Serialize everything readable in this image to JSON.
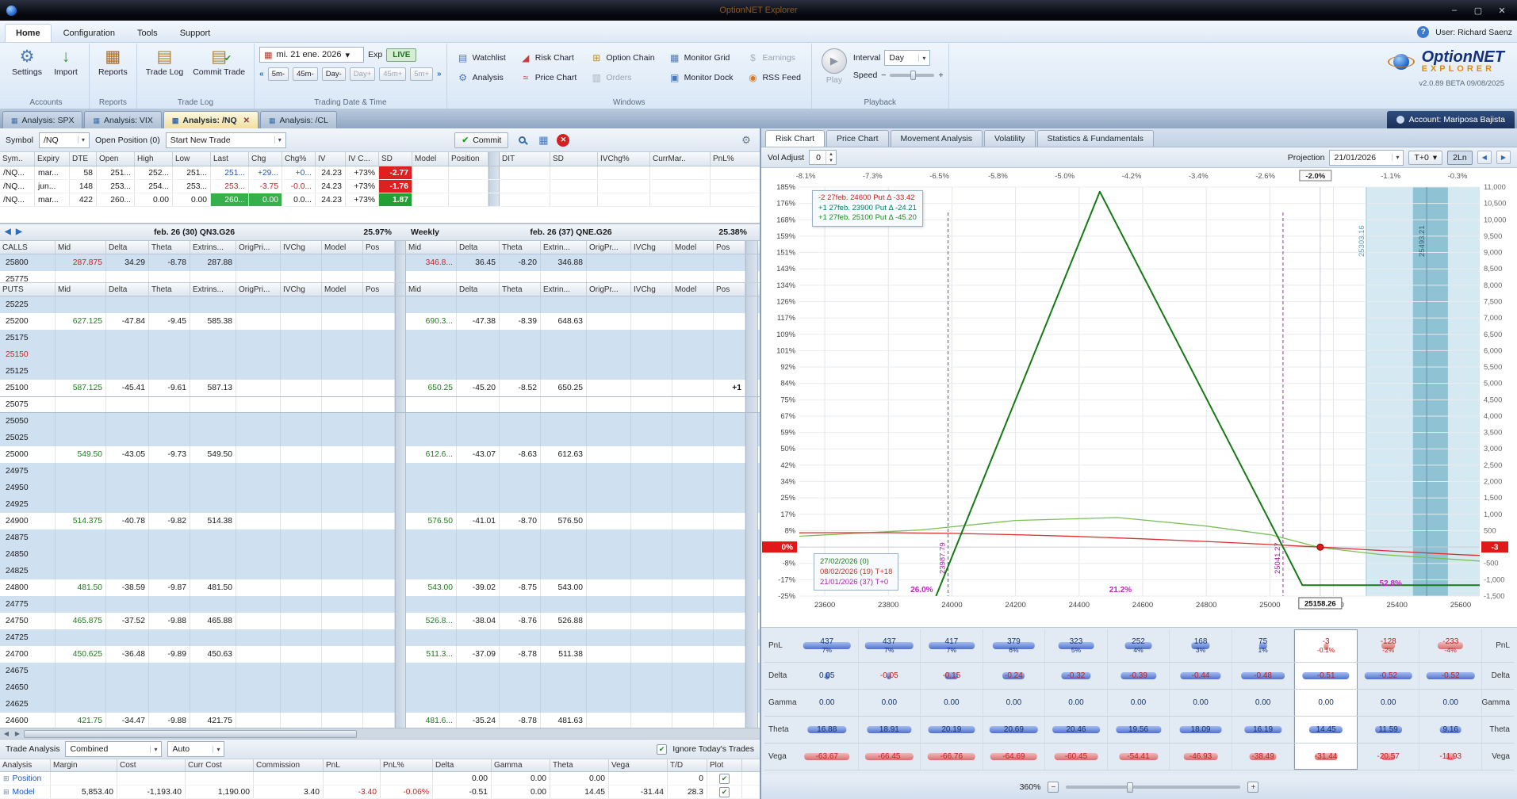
{
  "titlebar": {
    "title": "OptionNET Explorer",
    "minimize": "–",
    "maximize": "▢",
    "close": "✕"
  },
  "menubar": {
    "items": [
      "Home",
      "Configuration",
      "Tools",
      "Support"
    ],
    "help": "?",
    "user": "User: Richard Saenz"
  },
  "ribbon": {
    "accounts": {
      "label": "Accounts",
      "settings": "Settings",
      "import": "Import"
    },
    "reports": {
      "label": "Reports",
      "reports": "Reports"
    },
    "tradelog": {
      "label": "Trade Log",
      "trade_log": "Trade Log",
      "commit_trade": "Commit Trade"
    },
    "datetime": {
      "label": "Trading Date & Time",
      "date": "mi. 21 ene. 2026",
      "exp": "Exp",
      "live": "LIVE",
      "steps": [
        "5m-",
        "45m-",
        "Day-",
        "Day+",
        "45m+",
        "5m+"
      ]
    },
    "windows": {
      "label": "Windows",
      "items": [
        {
          "label": "Watchlist",
          "icon": "watchlist-icon",
          "enabled": true
        },
        {
          "label": "Analysis",
          "icon": "analysis-icon",
          "enabled": true
        },
        {
          "label": "Risk Chart",
          "icon": "risk-chart-icon",
          "enabled": true
        },
        {
          "label": "Price Chart",
          "icon": "price-chart-icon",
          "enabled": true
        },
        {
          "label": "Option Chain",
          "icon": "option-chain-icon",
          "enabled": true
        },
        {
          "label": "Orders",
          "icon": "orders-icon",
          "enabled": false
        },
        {
          "label": "Monitor Grid",
          "icon": "monitor-grid-icon",
          "enabled": true
        },
        {
          "label": "Monitor Dock",
          "icon": "monitor-dock-icon",
          "enabled": true
        },
        {
          "label": "Earnings",
          "icon": "earnings-icon",
          "enabled": false
        },
        {
          "label": "RSS Feed",
          "icon": "rss-feed-icon",
          "enabled": true
        }
      ]
    },
    "playback": {
      "label": "Playback",
      "play": "Play",
      "interval_label": "Interval",
      "interval_value": "Day",
      "speed_label": "Speed"
    },
    "logo": {
      "name1": "OptionNET",
      "name2": "EXPLORER",
      "version": "v2.0.89 BETA 09/08/2025"
    }
  },
  "tabstrip": {
    "tabs": [
      {
        "label": "Analysis: SPX"
      },
      {
        "label": "Analysis: VIX"
      },
      {
        "label": "Analysis: /NQ",
        "active": true
      },
      {
        "label": "Analysis: /CL"
      }
    ],
    "account": "Account: Mariposa Bajista"
  },
  "left": {
    "toolbar": {
      "symbol_label": "Symbol",
      "symbol_value": "/NQ",
      "open_position": "Open Position (0)",
      "trade_combo": "Start New Trade",
      "commit": "Commit"
    },
    "futures": {
      "headers": [
        "Sym..",
        "Expiry",
        "DTE",
        "Open",
        "High",
        "Low",
        "Last",
        "Chg",
        "Chg%",
        "IV",
        "IV C...",
        "SD",
        "Model",
        "Position"
      ],
      "headers2": [
        "DIT",
        "SD",
        "IVChg%",
        "CurrMar..",
        "PnL%"
      ],
      "rows": [
        {
          "cells": [
            "/NQ...",
            "mar...",
            "58",
            "251...",
            "252...",
            "251...",
            "251...",
            "+29...",
            "+0...",
            "24.23",
            "+73%",
            "-2.77",
            "",
            ""
          ],
          "cls": {
            "6": "c-up",
            "7": "c-up",
            "8": "c-up",
            "11": "badge-red"
          }
        },
        {
          "cells": [
            "/NQ...",
            "jun...",
            "148",
            "253...",
            "254...",
            "253...",
            "253...",
            "-3.75",
            "-0.0...",
            "24.23",
            "+73%",
            "-1.76",
            "",
            ""
          ],
          "cls": {
            "6": "c-dn",
            "7": "c-dn",
            "8": "c-dn",
            "11": "badge-red"
          }
        },
        {
          "cells": [
            "/NQ...",
            "mar...",
            "422",
            "260...",
            "0.00",
            "0.00",
            "260...",
            "0.00",
            "0.0...",
            "24.23",
            "+73%",
            "1.87",
            "",
            ""
          ],
          "cls": {
            "6": "flash-up",
            "7": "flash-up",
            "11": "badge-green"
          }
        }
      ]
    },
    "chain": {
      "exp1": {
        "title": "feb. 26 (30)  QN3.G26",
        "iv": "25.97%"
      },
      "exp2": {
        "prefix": "Weekly",
        "title": "feb. 26 (37)  QNE.G26",
        "iv": "25.38%"
      },
      "calls_label": "CALLS",
      "puts_label": "PUTS",
      "col_headers": [
        "Mid",
        "Delta",
        "Theta",
        "Extrins...",
        "OrigPri...",
        "IVChg",
        "Model",
        "Pos"
      ],
      "col_headers2": [
        "Mid",
        "Delta",
        "Theta",
        "Extrin...",
        "OrigPr...",
        "IVChg",
        "Model",
        "Pos"
      ],
      "calls": [
        {
          "strike": "25800",
          "bg": "b",
          "g1": [
            "287.875",
            "34.29",
            "-8.78",
            "287.88"
          ],
          "g2": [
            "346.8...",
            "36.45",
            "-8.20",
            "346.88"
          ]
        },
        {
          "strike": "25775",
          "bg": "w"
        }
      ],
      "puts": [
        {
          "strike": "25225"
        },
        {
          "strike": "25200",
          "g1": [
            "627.125",
            "-47.84",
            "-9.45",
            "585.38"
          ],
          "g2": [
            "690.3...",
            "-47.38",
            "-8.39",
            "648.63"
          ]
        },
        {
          "strike": "25175"
        },
        {
          "strike": "25150",
          "sc": "red"
        },
        {
          "strike": "25125"
        },
        {
          "strike": "25100",
          "g1": [
            "587.125",
            "-45.41",
            "-9.61",
            "587.13"
          ],
          "g2": [
            "650.25",
            "-45.20",
            "-8.52",
            "650.25"
          ],
          "pos2": "+1"
        },
        {
          "strike": "25075",
          "sel": true
        },
        {
          "strike": "25050"
        },
        {
          "strike": "25025"
        },
        {
          "strike": "25000",
          "g1": [
            "549.50",
            "-43.05",
            "-9.73",
            "549.50"
          ],
          "g2": [
            "612.6...",
            "-43.07",
            "-8.63",
            "612.63"
          ]
        },
        {
          "strike": "24975"
        },
        {
          "strike": "24950"
        },
        {
          "strike": "24925"
        },
        {
          "strike": "24900",
          "g1": [
            "514.375",
            "-40.78",
            "-9.82",
            "514.38"
          ],
          "g2": [
            "576.50",
            "-41.01",
            "-8.70",
            "576.50"
          ]
        },
        {
          "strike": "24875"
        },
        {
          "strike": "24850"
        },
        {
          "strike": "24825"
        },
        {
          "strike": "24800",
          "g1": [
            "481.50",
            "-38.59",
            "-9.87",
            "481.50"
          ],
          "g2": [
            "543.00",
            "-39.02",
            "-8.75",
            "543.00"
          ]
        },
        {
          "strike": "24775"
        },
        {
          "strike": "24750",
          "g1": [
            "465.875",
            "-37.52",
            "-9.88",
            "465.88"
          ],
          "g2": [
            "526.8...",
            "-38.04",
            "-8.76",
            "526.88"
          ]
        },
        {
          "strike": "24725"
        },
        {
          "strike": "24700",
          "g1": [
            "450.625",
            "-36.48",
            "-9.89",
            "450.63"
          ],
          "g2": [
            "511.3...",
            "-37.09",
            "-8.78",
            "511.38"
          ]
        },
        {
          "strike": "24675"
        },
        {
          "strike": "24650"
        },
        {
          "strike": "24625"
        },
        {
          "strike": "24600",
          "g1": [
            "421.75",
            "-34.47",
            "-9.88",
            "421.75"
          ],
          "g2": [
            "481.6...",
            "-35.24",
            "-8.78",
            "481.63"
          ]
        }
      ]
    },
    "analysis": {
      "trade_analysis_label": "Trade Analysis",
      "combined": "Combined",
      "auto": "Auto",
      "ignore": "Ignore Today's Trades",
      "headers": [
        "Analysis",
        "Margin",
        "Cost",
        "Curr Cost",
        "Commission",
        "PnL",
        "PnL%",
        "Delta",
        "Gamma",
        "Theta",
        "Vega",
        "T/D",
        "Plot"
      ],
      "rows": [
        {
          "name": "Position",
          "cells": [
            "",
            "",
            "",
            "",
            "",
            "",
            "0.00",
            "0.00",
            "0.00",
            "",
            "0"
          ],
          "plot": true
        },
        {
          "name": "Model",
          "cells": [
            "5,853.40",
            "-1,193.40",
            "1,190.00",
            "3.40",
            "-3.40",
            "-0.06%",
            "-0.51",
            "0.00",
            "14.45",
            "-31.44",
            "28.3"
          ],
          "cls": {
            "4": "c-red",
            "5": "c-red"
          },
          "plot": true
        }
      ]
    }
  },
  "right": {
    "tabs": [
      {
        "label": "Risk Chart",
        "active": true
      },
      {
        "label": "Price Chart"
      },
      {
        "label": "Movement Analysis"
      },
      {
        "label": "Volatility"
      },
      {
        "label": "Statistics & Fundamentals"
      }
    ],
    "controls": {
      "vol_adjust_label": "Vol Adjust",
      "vol_adjust_value": "0",
      "projection_label": "Projection",
      "projection_date": "21/01/2026",
      "t0": "T+0",
      "lines": "2Ln"
    },
    "chart": {
      "x_range": [
        23520,
        25660
      ],
      "y_range": [
        -1500,
        11000
      ],
      "x_ticks": [
        23600,
        23800,
        24000,
        24200,
        24400,
        24600,
        24800,
        25000,
        25200,
        25400,
        25600
      ],
      "y_ticks": [
        {
          "v": 11000,
          "d": "11,000",
          "p": "185%"
        },
        {
          "v": 10500,
          "d": "10,500",
          "p": "176%"
        },
        {
          "v": 10000,
          "d": "10,000",
          "p": "168%"
        },
        {
          "v": 9500,
          "d": "9,500",
          "p": "159%"
        },
        {
          "v": 9000,
          "d": "9,000",
          "p": "151%"
        },
        {
          "v": 8500,
          "d": "8,500",
          "p": "143%"
        },
        {
          "v": 8000,
          "d": "8,000",
          "p": "134%"
        },
        {
          "v": 7500,
          "d": "7,500",
          "p": "126%"
        },
        {
          "v": 7000,
          "d": "7,000",
          "p": "117%"
        },
        {
          "v": 6500,
          "d": "6,500",
          "p": "109%"
        },
        {
          "v": 6000,
          "d": "6,000",
          "p": "101%"
        },
        {
          "v": 5500,
          "d": "5,500",
          "p": "92%"
        },
        {
          "v": 5000,
          "d": "5,000",
          "p": "84%"
        },
        {
          "v": 4500,
          "d": "4,500",
          "p": "75%"
        },
        {
          "v": 4000,
          "d": "4,000",
          "p": "67%"
        },
        {
          "v": 3500,
          "d": "3,500",
          "p": "59%"
        },
        {
          "v": 3000,
          "d": "3,000",
          "p": "50%"
        },
        {
          "v": 2500,
          "d": "2,500",
          "p": "42%"
        },
        {
          "v": 2000,
          "d": "2,000",
          "p": "34%"
        },
        {
          "v": 1500,
          "d": "1,500",
          "p": "25%"
        },
        {
          "v": 1000,
          "d": "1,000",
          "p": "17%"
        },
        {
          "v": 500,
          "d": "500",
          "p": "8%"
        },
        {
          "v": 0,
          "d": "-3",
          "p": "0%",
          "badge": true
        },
        {
          "v": -500,
          "d": "-500",
          "p": "-8%"
        },
        {
          "v": -1000,
          "d": "-1,000",
          "p": "-17%"
        },
        {
          "v": -1500,
          "d": "-1,500",
          "p": "-25%"
        }
      ],
      "top_axis": [
        {
          "t": "-8.1%"
        },
        {
          "t": "-7.3%"
        },
        {
          "t": "-6.5%"
        },
        {
          "t": "-5.8%"
        },
        {
          "t": "-5.0%"
        },
        {
          "t": "-4.2%"
        },
        {
          "t": "-3.4%"
        },
        {
          "t": "-2.6%"
        },
        {
          "t": "-2.0%",
          "boxed": true
        },
        {
          "t": "-1.1%"
        },
        {
          "t": "-0.3%"
        }
      ],
      "current_price_label": "25158.26",
      "marker": {
        "price": 25158.26,
        "value": -3
      },
      "breakevens": [
        {
          "price": 23987.79,
          "label": "23987.79"
        },
        {
          "price": 25041.27,
          "label": "25041.27"
        }
      ],
      "sd_band": {
        "line1": {
          "price": 25303.16,
          "label": "25303.16"
        },
        "line2": {
          "price": 25493.21,
          "label": "25493.21"
        },
        "fill_from": 25303.16,
        "inner_from": 25450,
        "inner_to": 25560
      },
      "prob_labels": [
        {
          "text": "26.0%",
          "price": 23905
        },
        {
          "text": "21.2%",
          "price": 24530
        },
        {
          "text": "52.8%",
          "price": 25380,
          "dy": -8
        }
      ],
      "legend": [
        {
          "text": "-2 27feb. 24600 Put Δ -33.42",
          "color": "#cc2222"
        },
        {
          "text": "+1 27feb. 23900 Put Δ -24.21",
          "color": "#008060"
        },
        {
          "text": "+1 27feb. 25100 Put Δ -45.20",
          "color": "#1e8a1e"
        }
      ],
      "tooltip": [
        {
          "text": "27/02/2026 (0)",
          "color": "#1e7d1e"
        },
        {
          "text": "08/02/2026 (19) T+18",
          "color": "#c03a2a"
        },
        {
          "text": "21/01/2026 (37) T+0",
          "color": "#b01eb0"
        }
      ],
      "series": {
        "t18": {
          "color": "#7cbf5a",
          "width": 1.3,
          "points": [
            [
              23520,
              330
            ],
            [
              23900,
              520
            ],
            [
              24200,
              810
            ],
            [
              24520,
              900
            ],
            [
              24800,
              640
            ],
            [
              25004,
              370
            ],
            [
              25158.26,
              -20
            ],
            [
              25350,
              -230
            ],
            [
              25660,
              -430
            ]
          ]
        },
        "t0": {
          "color": "#d93030",
          "width": 1.3,
          "points": [
            [
              23520,
              432
            ],
            [
              23592,
              437
            ],
            [
              23797,
              437
            ],
            [
              24003,
              417
            ],
            [
              24182,
              379
            ],
            [
              24388,
              323
            ],
            [
              24593,
              252
            ],
            [
              24798,
              168
            ],
            [
              25004,
              75
            ],
            [
              25158.26,
              -3
            ],
            [
              25389,
              -128
            ],
            [
              25595,
              -233
            ],
            [
              25660,
              -258
            ]
          ]
        },
        "expiration": {
          "color": "#157a15",
          "width": 2,
          "points": [
            [
              23950,
              -1500
            ],
            [
              24465,
              10860
            ],
            [
              25041.27,
              0
            ],
            [
              25102,
              -1165
            ],
            [
              25660,
              -1165
            ]
          ]
        }
      }
    },
    "greeks": {
      "row_labels": [
        "PnL",
        "Delta",
        "Gamma",
        "Theta",
        "Vega"
      ],
      "current_col": 8,
      "pnl_vals": [
        "437",
        "437",
        "417",
        "379",
        "323",
        "252",
        "168",
        "75",
        "-3",
        "-128",
        "-233"
      ],
      "pnl_pcts": [
        "7%",
        "7%",
        "7%",
        "6%",
        "5%",
        "4%",
        "3%",
        "1%",
        "-0.1%",
        "-2%",
        "-4%"
      ],
      "delta": [
        "0.05",
        "-0.05",
        "-0.15",
        "-0.24",
        "-0.32",
        "-0.39",
        "-0.44",
        "-0.48",
        "-0.51",
        "-0.52",
        "-0.52"
      ],
      "gamma": [
        "0.00",
        "0.00",
        "0.00",
        "0.00",
        "0.00",
        "0.00",
        "0.00",
        "0.00",
        "0.00",
        "0.00",
        "0.00"
      ],
      "theta": [
        "16.88",
        "18.91",
        "20.19",
        "20.69",
        "20.46",
        "19.56",
        "18.09",
        "16.19",
        "14.45",
        "11.59",
        "9.16"
      ],
      "vega": [
        "-63.67",
        "-66.45",
        "-66.76",
        "-64.69",
        "-60.45",
        "-54.41",
        "-46.93",
        "-38.49",
        "-31.44",
        "-20.57",
        "-11.93"
      ]
    },
    "zoom": {
      "value": "360%"
    }
  }
}
